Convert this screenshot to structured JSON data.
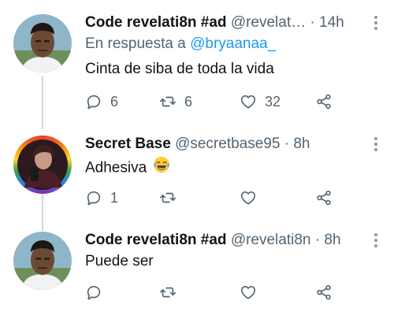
{
  "tweets": [
    {
      "author_name": "Code revelati8n #ad",
      "handle": "@revelat…",
      "separator": "·",
      "time": "14h",
      "reply_prefix": "En respuesta a",
      "reply_handle": "@bryaanaa_",
      "text": "Cinta de siba de toda la vida",
      "replies": "6",
      "retweets": "6",
      "likes": "32"
    },
    {
      "author_name": "Secret Base",
      "handle": "@secretbase95",
      "separator": "·",
      "time": "8h",
      "text": "Adhesiva",
      "emoji": "face-with-tears-of-joy",
      "replies": "1",
      "retweets": "",
      "likes": ""
    },
    {
      "author_name": "Code revelati8n #ad",
      "handle": "@revelati8n",
      "separator": "·",
      "time": "8h",
      "text": "Puede ser",
      "replies": "",
      "retweets": "",
      "likes": ""
    }
  ],
  "icons": {
    "reply": "reply-icon",
    "retweet": "retweet-icon",
    "like": "heart-icon",
    "share": "share-icon",
    "more": "more-icon"
  },
  "colors": {
    "name": "#0f1419",
    "secondary": "#536471",
    "link": "#1d9bf0",
    "thread_line": "#cfd9de"
  }
}
